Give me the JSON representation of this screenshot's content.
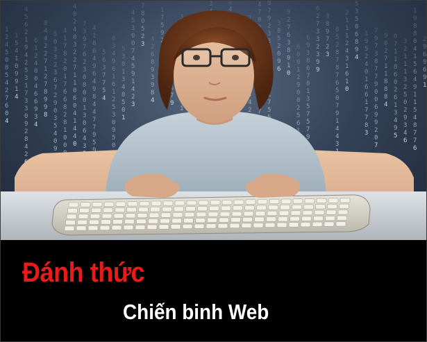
{
  "image": {
    "scene": "boy-with-glasses-typing-on-keyboard",
    "background": "digital-code-rain"
  },
  "caption": {
    "headline": "Đánh thức",
    "subheadline": "Chiến binh Web"
  },
  "colors": {
    "caption_background": "#000000",
    "headline": "#e81b1b",
    "subheadline": "#ffffff"
  }
}
